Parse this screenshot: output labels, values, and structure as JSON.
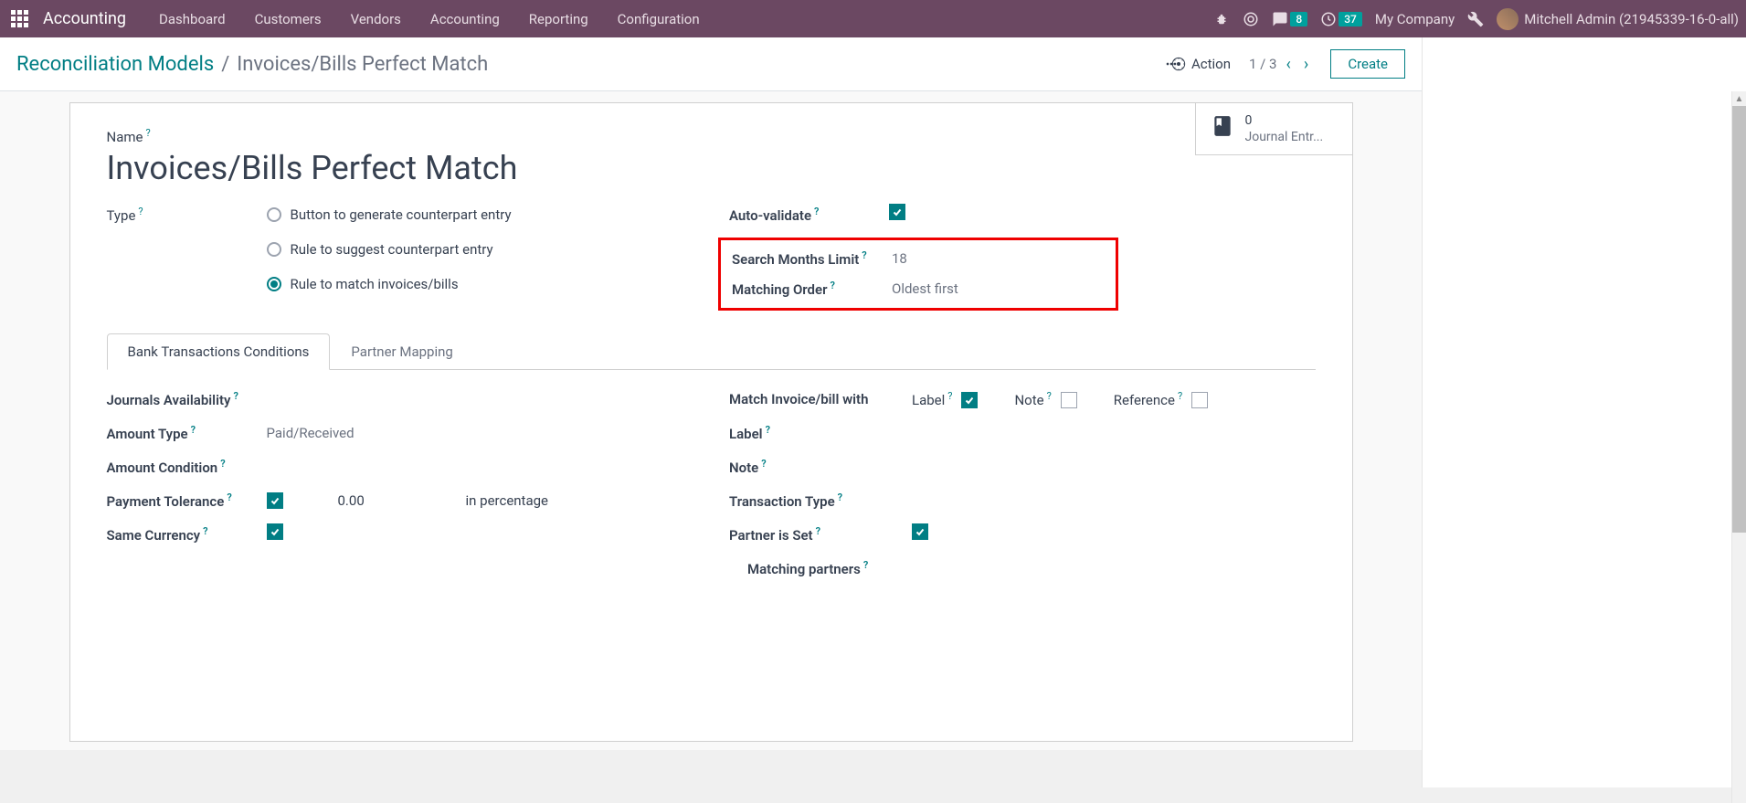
{
  "navbar": {
    "app_title": "Accounting",
    "links": [
      "Dashboard",
      "Customers",
      "Vendors",
      "Accounting",
      "Reporting",
      "Configuration"
    ],
    "chat_count": "8",
    "activity_count": "37",
    "company": "My Company",
    "user_name": "Mitchell Admin (21945339-16-0-all)"
  },
  "control": {
    "breadcrumb_parent": "Reconciliation Models",
    "breadcrumb_current": "Invoices/Bills Perfect Match",
    "action_label": "Action",
    "pager": "1 / 3",
    "create_label": "Create"
  },
  "statbar": {
    "count": "0",
    "label": "Journal Entr..."
  },
  "form": {
    "name_label": "Name",
    "name_value": "Invoices/Bills Perfect Match",
    "type_label": "Type",
    "type_options": {
      "0": "Button to generate counterpart entry",
      "1": "Rule to suggest counterpart entry",
      "2": "Rule to match invoices/bills"
    },
    "auto_validate_label": "Auto-validate",
    "search_months_label": "Search Months Limit",
    "search_months_value": "18",
    "matching_order_label": "Matching Order",
    "matching_order_value": "Oldest first"
  },
  "tabs": {
    "bank": "Bank Transactions Conditions",
    "partner": "Partner Mapping"
  },
  "bank_tab": {
    "left": {
      "journals_label": "Journals Availability",
      "amount_type_label": "Amount Type",
      "amount_type_value": "Paid/Received",
      "amount_condition_label": "Amount Condition",
      "payment_tolerance_label": "Payment Tolerance",
      "payment_tolerance_value": "0.00",
      "payment_tolerance_unit": "in percentage",
      "same_currency_label": "Same Currency"
    },
    "right": {
      "match_invoice_label": "Match Invoice/bill with",
      "opt_label": "Label",
      "opt_note": "Note",
      "opt_reference": "Reference",
      "label_label": "Label",
      "note_label": "Note",
      "transaction_type_label": "Transaction Type",
      "partner_set_label": "Partner is Set",
      "matching_partners_label": "Matching partners"
    }
  }
}
